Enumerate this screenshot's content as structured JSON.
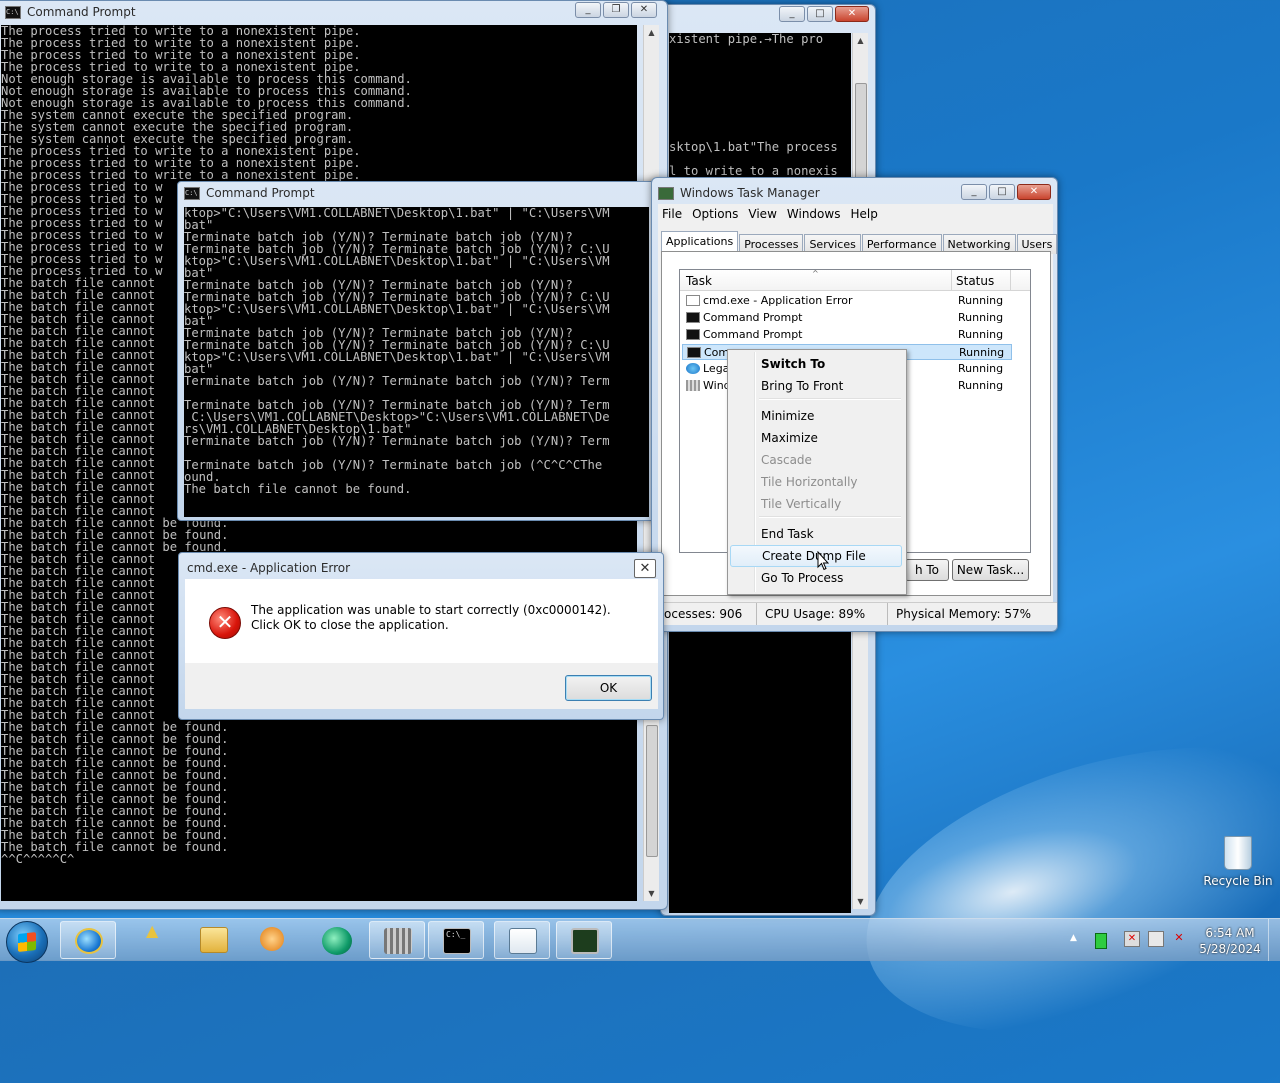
{
  "cmd_main": {
    "title": "Command Prompt",
    "lines": [
      "The process tried to write to a nonexistent pipe.",
      "The process tried to write to a nonexistent pipe.",
      "The process tried to write to a nonexistent pipe.",
      "The process tried to write to a nonexistent pipe.",
      "Not enough storage is available to process this command.",
      "Not enough storage is available to process this command.",
      "Not enough storage is available to process this command.",
      "The system cannot execute the specified program.",
      "The system cannot execute the specified program.",
      "The system cannot execute the specified program.",
      "The process tried to write to a nonexistent pipe.",
      "The process tried to write to a nonexistent pipe.",
      "The process tried to write to a nonexistent pipe.",
      "The process tried to w",
      "The process tried to w",
      "The process tried to w",
      "The process tried to w",
      "The process tried to w",
      "The process tried to w",
      "The process tried to w",
      "The process tried to w",
      "The batch file cannot",
      "The batch file cannot",
      "The batch file cannot",
      "The batch file cannot",
      "The batch file cannot",
      "The batch file cannot",
      "The batch file cannot",
      "The batch file cannot",
      "The batch file cannot",
      "The batch file cannot",
      "The batch file cannot",
      "The batch file cannot",
      "The batch file cannot",
      "The batch file cannot",
      "The batch file cannot",
      "The batch file cannot",
      "The batch file cannot",
      "The batch file cannot",
      "The batch file cannot",
      "The batch file cannot",
      "The batch file cannot be found.",
      "The batch file cannot be found.",
      "The batch file cannot be found.",
      "The batch file cannot",
      "The batch file cannot",
      "The batch file cannot",
      "The batch file cannot",
      "The batch file cannot",
      "The batch file cannot",
      "The batch file cannot",
      "The batch file cannot",
      "The batch file cannot",
      "The batch file cannot",
      "The batch file cannot",
      "The batch file cannot",
      "The batch file cannot",
      "The batch file cannot",
      "The batch file cannot be found.",
      "The batch file cannot be found.",
      "The batch file cannot be found.",
      "The batch file cannot be found.",
      "The batch file cannot be found.",
      "The batch file cannot be found.",
      "The batch file cannot be found.",
      "The batch file cannot be found.",
      "The batch file cannot be found.",
      "The batch file cannot be found.",
      "The batch file cannot be found.",
      "^^C^^^^^C^"
    ]
  },
  "cmd_back": {
    "lines": [
      "xistent pipe.→The pro",
      "",
      "",
      "",
      "",
      "",
      "",
      "",
      "",
      "sktop\\1.bat\"The process",
      "",
      "l to write to a nonexis"
    ]
  },
  "cmd_mid": {
    "title": "Command Prompt",
    "lines": [
      "ktop>\"C:\\Users\\VM1.COLLABNET\\Desktop\\1.bat\" | \"C:\\Users\\VM",
      "bat\"",
      "Terminate batch job (Y/N)? Terminate batch job (Y/N)?",
      "Terminate batch job (Y/N)? Terminate batch job (Y/N)? C:\\U",
      "ktop>\"C:\\Users\\VM1.COLLABNET\\Desktop\\1.bat\" | \"C:\\Users\\VM",
      "bat\"",
      "Terminate batch job (Y/N)? Terminate batch job (Y/N)?",
      "Terminate batch job (Y/N)? Terminate batch job (Y/N)? C:\\U",
      "ktop>\"C:\\Users\\VM1.COLLABNET\\Desktop\\1.bat\" | \"C:\\Users\\VM",
      "bat\"",
      "Terminate batch job (Y/N)? Terminate batch job (Y/N)?",
      "Terminate batch job (Y/N)? Terminate batch job (Y/N)? C:\\U",
      "ktop>\"C:\\Users\\VM1.COLLABNET\\Desktop\\1.bat\" | \"C:\\Users\\VM",
      "bat\"",
      "Terminate batch job (Y/N)? Terminate batch job (Y/N)? Term",
      "",
      "Terminate batch job (Y/N)? Terminate batch job (Y/N)? Term",
      " C:\\Users\\VM1.COLLABNET\\Desktop>\"C:\\Users\\VM1.COLLABNET\\De",
      "rs\\VM1.COLLABNET\\Desktop\\1.bat\"",
      "Terminate batch job (Y/N)? Terminate batch job (Y/N)? Term",
      "",
      "Terminate batch job (Y/N)? Terminate batch job (^C^C^CThe",
      "ound.",
      "The batch file cannot be found."
    ]
  },
  "task_manager": {
    "title": "Windows Task Manager",
    "menu": [
      "File",
      "Options",
      "View",
      "Windows",
      "Help"
    ],
    "tabs": [
      "Applications",
      "Processes",
      "Services",
      "Performance",
      "Networking",
      "Users"
    ],
    "columns": {
      "task": "Task",
      "status": "Status"
    },
    "rows": [
      {
        "name": "cmd.exe - Application Error",
        "status": "Running"
      },
      {
        "name": "Command Prompt",
        "status": "Running"
      },
      {
        "name": "Command Prompt",
        "status": "Running"
      },
      {
        "name": "Comm",
        "status": "Running"
      },
      {
        "name": "Lega",
        "status": "Running"
      },
      {
        "name": "Wind",
        "status": "Running"
      }
    ],
    "switch_to": "h To",
    "new_task": "New Task...",
    "status_processes": "ocesses: 906",
    "status_cpu": "CPU Usage: 89%",
    "status_memory": "Physical Memory: 57%"
  },
  "context_menu": {
    "items": [
      {
        "label": "Switch To",
        "state": "bold"
      },
      {
        "label": "Bring To Front",
        "state": "normal"
      },
      {
        "label": "Minimize",
        "state": "normal"
      },
      {
        "label": "Maximize",
        "state": "normal"
      },
      {
        "label": "Cascade",
        "state": "disabled"
      },
      {
        "label": "Tile Horizontally",
        "state": "disabled"
      },
      {
        "label": "Tile Vertically",
        "state": "disabled"
      },
      {
        "label": "End Task",
        "state": "normal"
      },
      {
        "label": "Create Dump File",
        "state": "hover"
      },
      {
        "label": "Go To Process",
        "state": "normal"
      }
    ]
  },
  "error_dialog": {
    "title": "cmd.exe - Application Error",
    "message": "The application was unable to start correctly (0xc0000142). Click OK to close the application.",
    "ok_label": "OK"
  },
  "desktop": {
    "recycle_bin": "Recycle Bin"
  },
  "taskbar": {
    "time": "6:54 AM",
    "date": "5/28/2024"
  }
}
